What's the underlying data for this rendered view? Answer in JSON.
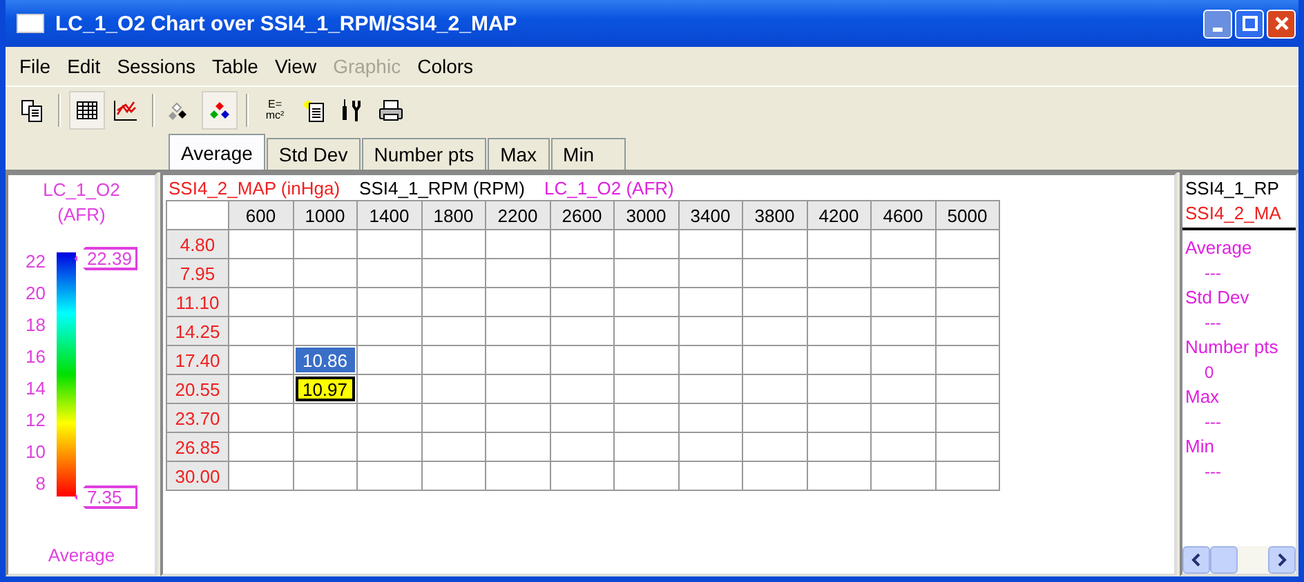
{
  "window": {
    "title": "LC_1_O2 Chart over SSI4_1_RPM/SSI4_2_MAP"
  },
  "menu": [
    {
      "label": "File",
      "disabled": false
    },
    {
      "label": "Edit",
      "disabled": false
    },
    {
      "label": "Sessions",
      "disabled": false
    },
    {
      "label": "Table",
      "disabled": false
    },
    {
      "label": "View",
      "disabled": false
    },
    {
      "label": "Graphic",
      "disabled": true
    },
    {
      "label": "Colors",
      "disabled": false
    }
  ],
  "toolbar": [
    {
      "kind": "copy",
      "pressed": false
    },
    {
      "kind": "sep"
    },
    {
      "kind": "table",
      "pressed": true
    },
    {
      "kind": "chart",
      "pressed": false
    },
    {
      "kind": "sep"
    },
    {
      "kind": "mono",
      "pressed": false
    },
    {
      "kind": "color",
      "pressed": true
    },
    {
      "kind": "sep"
    },
    {
      "kind": "formula",
      "pressed": false,
      "lines": [
        "E=",
        "mc²"
      ]
    },
    {
      "kind": "note",
      "pressed": false
    },
    {
      "kind": "tools",
      "pressed": false
    },
    {
      "kind": "print",
      "pressed": false
    }
  ],
  "tabs": [
    {
      "label": "Average",
      "selected": true
    },
    {
      "label": "Std Dev",
      "selected": false
    },
    {
      "label": "Number pts",
      "selected": false
    },
    {
      "label": "Max",
      "selected": false
    },
    {
      "label": "Min",
      "selected": false
    }
  ],
  "legend": {
    "title": "LC_1_O2",
    "unit": "(AFR)",
    "ticks": [
      "22",
      "20",
      "18",
      "16",
      "14",
      "12",
      "10",
      "8"
    ],
    "max_marker": "22.39",
    "min_marker": "7.35",
    "footer": "Average"
  },
  "table": {
    "y_axis": "SSI4_2_MAP (inHga)",
    "x_axis": "SSI4_1_RPM (RPM)",
    "z_axis": "LC_1_O2 (AFR)",
    "columns": [
      "600",
      "1000",
      "1400",
      "1800",
      "2200",
      "2600",
      "3000",
      "3400",
      "3800",
      "4200",
      "4600",
      "5000"
    ],
    "rows": [
      {
        "label": "4.80",
        "cells": [
          {
            "kind": "empty"
          },
          {
            "kind": "empty"
          },
          {
            "kind": "empty"
          },
          {
            "kind": "empty"
          },
          {
            "kind": "empty"
          },
          {
            "kind": "empty"
          },
          {
            "kind": "empty"
          },
          {
            "kind": "empty"
          },
          {
            "kind": "empty"
          },
          {
            "kind": "empty"
          },
          {
            "kind": "empty"
          },
          {
            "kind": "empty"
          }
        ]
      },
      {
        "label": "7.95",
        "cells": [
          {
            "kind": "empty"
          },
          {
            "kind": "empty"
          },
          {
            "kind": "empty"
          },
          {
            "kind": "empty"
          },
          {
            "kind": "empty"
          },
          {
            "kind": "empty"
          },
          {
            "kind": "empty"
          },
          {
            "kind": "empty"
          },
          {
            "kind": "empty"
          },
          {
            "kind": "empty"
          },
          {
            "kind": "empty"
          },
          {
            "kind": "empty"
          }
        ]
      },
      {
        "label": "11.10",
        "cells": [
          {
            "kind": "empty"
          },
          {
            "kind": "empty"
          },
          {
            "kind": "empty"
          },
          {
            "kind": "empty"
          },
          {
            "kind": "empty"
          },
          {
            "kind": "empty"
          },
          {
            "kind": "empty"
          },
          {
            "kind": "empty"
          },
          {
            "kind": "empty"
          },
          {
            "kind": "empty"
          },
          {
            "kind": "empty"
          },
          {
            "kind": "empty"
          }
        ]
      },
      {
        "label": "14.25",
        "cells": [
          {
            "kind": "empty"
          },
          {
            "kind": "empty"
          },
          {
            "kind": "empty"
          },
          {
            "kind": "empty"
          },
          {
            "kind": "empty"
          },
          {
            "kind": "empty"
          },
          {
            "kind": "empty"
          },
          {
            "kind": "empty"
          },
          {
            "kind": "empty"
          },
          {
            "kind": "empty"
          },
          {
            "kind": "empty"
          },
          {
            "kind": "empty"
          }
        ]
      },
      {
        "label": "17.40",
        "cells": [
          {
            "kind": "empty"
          },
          {
            "kind": "selected",
            "value": "10.86"
          },
          {
            "kind": "empty"
          },
          {
            "kind": "empty"
          },
          {
            "kind": "empty"
          },
          {
            "kind": "empty"
          },
          {
            "kind": "empty"
          },
          {
            "kind": "empty"
          },
          {
            "kind": "empty"
          },
          {
            "kind": "empty"
          },
          {
            "kind": "empty"
          },
          {
            "kind": "empty"
          }
        ]
      },
      {
        "label": "20.55",
        "cells": [
          {
            "kind": "empty"
          },
          {
            "kind": "current",
            "value": "10.97"
          },
          {
            "kind": "empty"
          },
          {
            "kind": "empty"
          },
          {
            "kind": "empty"
          },
          {
            "kind": "empty"
          },
          {
            "kind": "empty"
          },
          {
            "kind": "empty"
          },
          {
            "kind": "empty"
          },
          {
            "kind": "empty"
          },
          {
            "kind": "empty"
          },
          {
            "kind": "empty"
          }
        ]
      },
      {
        "label": "23.70",
        "cells": [
          {
            "kind": "empty"
          },
          {
            "kind": "empty"
          },
          {
            "kind": "empty"
          },
          {
            "kind": "empty"
          },
          {
            "kind": "empty"
          },
          {
            "kind": "empty"
          },
          {
            "kind": "empty"
          },
          {
            "kind": "empty"
          },
          {
            "kind": "empty"
          },
          {
            "kind": "empty"
          },
          {
            "kind": "empty"
          },
          {
            "kind": "empty"
          }
        ]
      },
      {
        "label": "26.85",
        "cells": [
          {
            "kind": "empty"
          },
          {
            "kind": "empty"
          },
          {
            "kind": "empty"
          },
          {
            "kind": "empty"
          },
          {
            "kind": "empty"
          },
          {
            "kind": "empty"
          },
          {
            "kind": "empty"
          },
          {
            "kind": "empty"
          },
          {
            "kind": "empty"
          },
          {
            "kind": "empty"
          },
          {
            "kind": "empty"
          },
          {
            "kind": "empty"
          }
        ]
      },
      {
        "label": "30.00",
        "cells": [
          {
            "kind": "empty"
          },
          {
            "kind": "empty"
          },
          {
            "kind": "empty"
          },
          {
            "kind": "empty"
          },
          {
            "kind": "empty"
          },
          {
            "kind": "empty"
          },
          {
            "kind": "empty"
          },
          {
            "kind": "empty"
          },
          {
            "kind": "empty"
          },
          {
            "kind": "empty"
          },
          {
            "kind": "empty"
          },
          {
            "kind": "empty"
          }
        ]
      }
    ]
  },
  "info_panel": {
    "x_channel": "SSI4_1_RP",
    "y_channel": "SSI4_2_MA",
    "stats": [
      {
        "label": "Average",
        "value": "---"
      },
      {
        "label": "Std Dev",
        "value": "---"
      },
      {
        "label": "Number pts",
        "value": "0"
      },
      {
        "label": "Max",
        "value": "---"
      },
      {
        "label": "Min",
        "value": "---"
      }
    ]
  }
}
